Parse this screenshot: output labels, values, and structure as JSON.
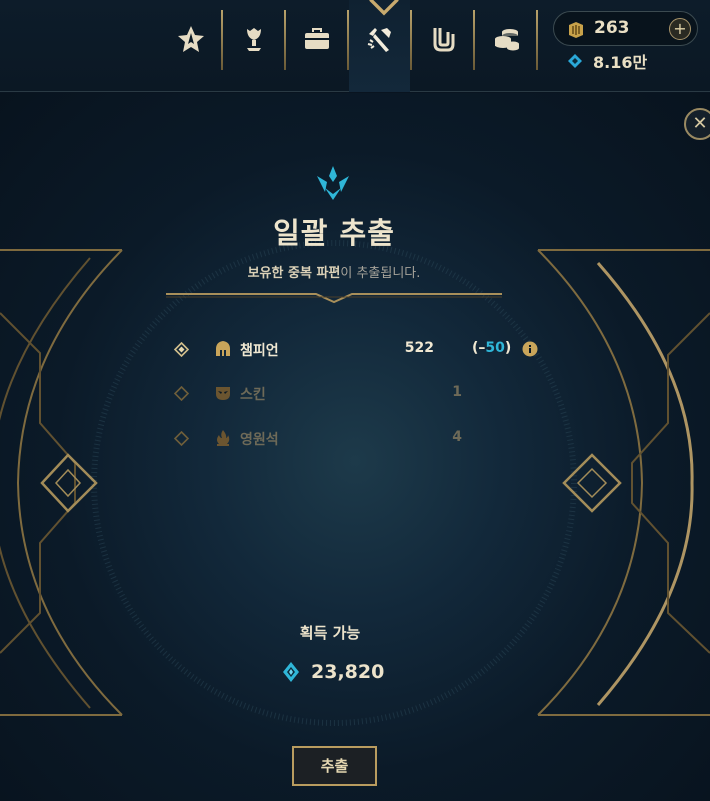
{
  "nav": {
    "items": [
      {
        "name": "clash-icon"
      },
      {
        "name": "trophy-icon"
      },
      {
        "name": "collection-icon"
      },
      {
        "name": "crafting-icon",
        "active": true
      },
      {
        "name": "missions-icon"
      },
      {
        "name": "store-icon"
      }
    ]
  },
  "wallet": {
    "rp_amount": "263",
    "plus_label": "+",
    "blue_essence": "8.16만"
  },
  "dialog": {
    "close_label": "✕",
    "title": "일괄 추출",
    "subtitle_bold": "보유한 중복 파편",
    "subtitle_rest": "이 추출됩니다.",
    "items": [
      {
        "label": "챔피언",
        "count": "522",
        "delta_open": "(–",
        "delta_value": "50",
        "delta_close": ")",
        "checked": true
      },
      {
        "label": "스킨",
        "count": "1",
        "checked": false
      },
      {
        "label": "영원석",
        "count": "4",
        "checked": false
      }
    ],
    "acquire_label": "획득 가능",
    "acquire_value": "23,820",
    "extract_button": "추출"
  },
  "colors": {
    "gold": "#c8aa6e",
    "blue_accent": "#2fb6d8",
    "background": "#091420"
  }
}
